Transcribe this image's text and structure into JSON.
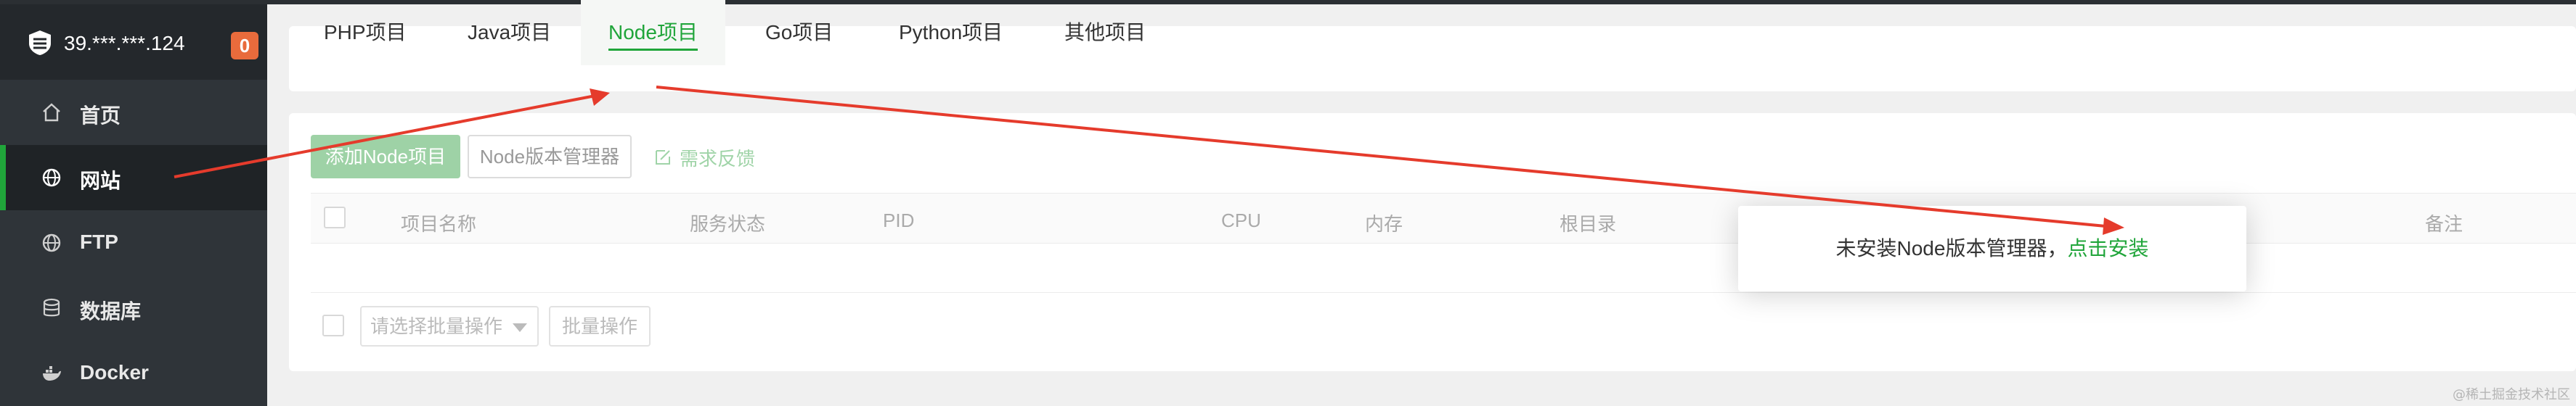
{
  "server": {
    "ip": "39.***.***.124",
    "badge": "0"
  },
  "sidebar": {
    "items": [
      {
        "label": "首页",
        "icon": "home-icon"
      },
      {
        "label": "网站",
        "icon": "globe-icon"
      },
      {
        "label": "FTP",
        "icon": "ftp-icon"
      },
      {
        "label": "数据库",
        "icon": "database-icon"
      },
      {
        "label": "Docker",
        "icon": "docker-icon"
      }
    ]
  },
  "tabs": [
    {
      "label": "PHP项目"
    },
    {
      "label": "Java项目"
    },
    {
      "label": "Node项目"
    },
    {
      "label": "Go项目"
    },
    {
      "label": "Python项目"
    },
    {
      "label": "其他项目"
    }
  ],
  "toolbar": {
    "add_label": "添加Node项目",
    "node_manager_label": "Node版本管理器",
    "feedback_label": "需求反馈"
  },
  "table": {
    "columns": [
      "项目名称",
      "服务状态",
      "PID",
      "CPU",
      "内存",
      "根目录",
      "备注"
    ]
  },
  "batch": {
    "select_placeholder": "请选择批量操作",
    "button_label": "批量操作"
  },
  "popup": {
    "message": "未安装Node版本管理器，",
    "link": "点击安装"
  },
  "watermark": "@稀土掘金技术社区",
  "colors": {
    "accent": "#20a53a",
    "annotation_arrow": "#e53b2c",
    "badge": "#e96b3c"
  }
}
